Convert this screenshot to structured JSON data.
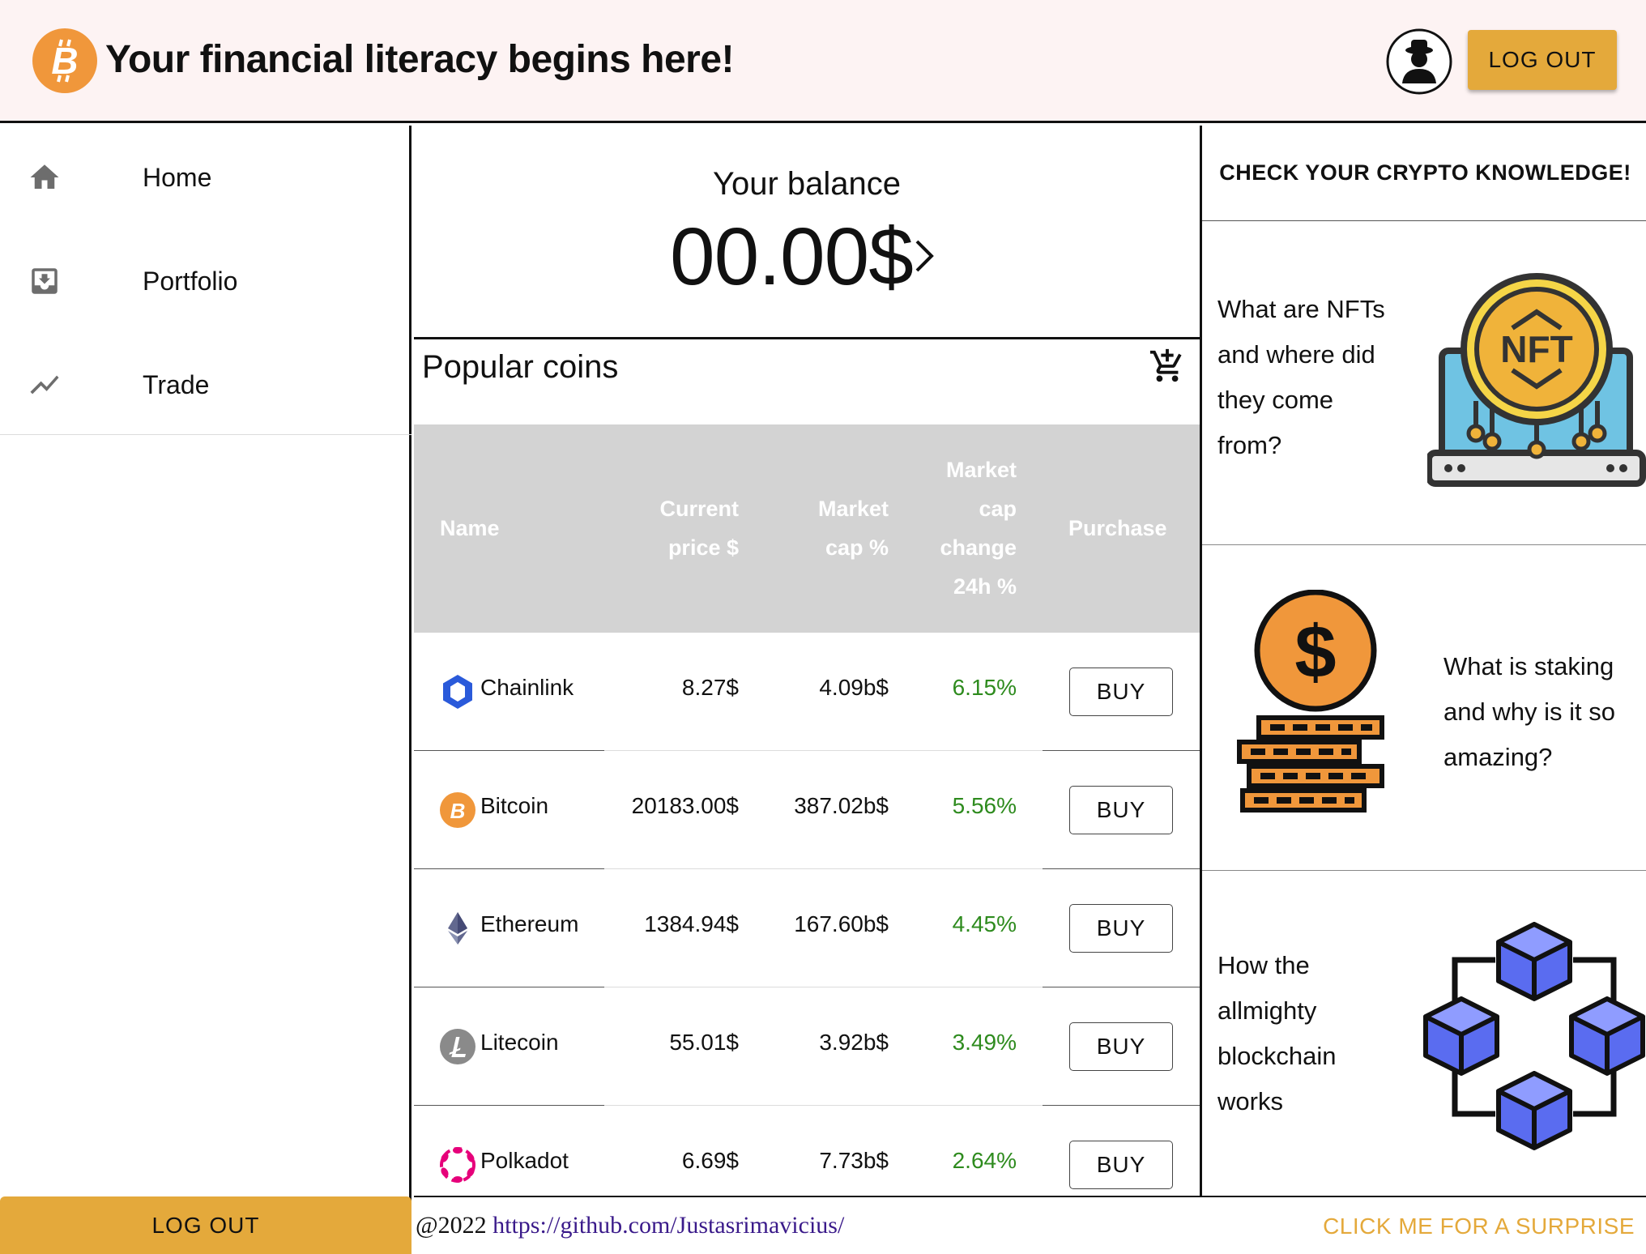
{
  "header": {
    "title": "Your financial literacy begins here!",
    "logout_label": "LOG OUT"
  },
  "sidebar": {
    "items": [
      {
        "label": "Home",
        "icon": "home-icon"
      },
      {
        "label": "Portfolio",
        "icon": "inbox-icon"
      },
      {
        "label": "Trade",
        "icon": "trending-up-icon"
      }
    ],
    "logout_label": "LOG OUT"
  },
  "balance": {
    "label": "Your balance",
    "value": "00.00$"
  },
  "coins": {
    "title": "Popular coins",
    "columns": {
      "name": "Name",
      "price": "Current price $",
      "cap": "Market cap %",
      "change": "Market cap change 24h %",
      "purchase": "Purchase"
    },
    "rows": [
      {
        "name": "Chainlink",
        "price": "8.27$",
        "cap": "4.09b$",
        "change": "6.15%",
        "buy": "BUY",
        "icon": "chainlink-icon"
      },
      {
        "name": "Bitcoin",
        "price": "20183.00$",
        "cap": "387.02b$",
        "change": "5.56%",
        "buy": "BUY",
        "icon": "bitcoin-icon"
      },
      {
        "name": "Ethereum",
        "price": "1384.94$",
        "cap": "167.60b$",
        "change": "4.45%",
        "buy": "BUY",
        "icon": "ethereum-icon"
      },
      {
        "name": "Litecoin",
        "price": "55.01$",
        "cap": "3.92b$",
        "change": "3.49%",
        "buy": "BUY",
        "icon": "litecoin-icon"
      },
      {
        "name": "Polkadot",
        "price": "6.69$",
        "cap": "7.73b$",
        "change": "2.64%",
        "buy": "BUY",
        "icon": "polkadot-icon"
      }
    ]
  },
  "quiz": {
    "header": "CHECK YOUR CRYPTO KNOWLEDGE!",
    "cards": [
      {
        "lines": [
          "What are NFTs",
          "and where did",
          "they come",
          "from?"
        ],
        "image": "nft-illustration"
      },
      {
        "lines": [
          "What is staking",
          "and why is it so",
          "amazing?"
        ],
        "image": "coin-stack-illustration"
      },
      {
        "lines": [
          "How the",
          "allmighty",
          "blockchain",
          "works"
        ],
        "image": "blockchain-illustration"
      }
    ]
  },
  "footer": {
    "copyright_prefix": "@2022 ",
    "link": "https://github.com/Justasrimavicius/",
    "surprise": "CLICK ME FOR A SURPRISE"
  },
  "colors": {
    "accent": "#e4a93b",
    "header_bg": "#fdf3f3",
    "positive": "#2e8b1e",
    "table_head_bg": "#d3d3d3"
  }
}
